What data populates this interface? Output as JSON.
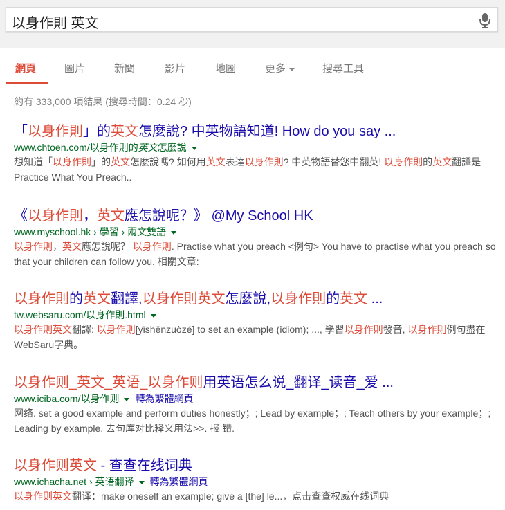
{
  "search": {
    "query": "以身作則 英文"
  },
  "tabs": [
    {
      "label": "網頁"
    },
    {
      "label": "圖片"
    },
    {
      "label": "新聞"
    },
    {
      "label": "影片"
    },
    {
      "label": "地圖"
    },
    {
      "label": "更多"
    },
    {
      "label": "搜尋工具"
    }
  ],
  "stats": "約有 333,000 項結果 (搜尋時間：0.24 秒)",
  "results": [
    {
      "title": [
        [
          "「",
          0
        ],
        [
          "以身作則",
          1
        ],
        [
          "」的",
          0
        ],
        [
          "英文",
          1
        ],
        [
          "怎麼說? 中英物語知道! How do you say ...",
          0
        ]
      ],
      "url": [
        [
          "www.chtoen.com/以身作則的",
          0
        ],
        [
          "英文",
          1
        ],
        [
          "怎麼說",
          0
        ]
      ],
      "translate": "",
      "snippet": [
        [
          "想知道「",
          0
        ],
        [
          "以身作則",
          1
        ],
        [
          "」的",
          0
        ],
        [
          "英文",
          1
        ],
        [
          "怎麼說嗎? 如何用",
          0
        ],
        [
          "英文",
          1
        ],
        [
          "表達",
          0
        ],
        [
          "以身作則",
          1
        ],
        [
          "? 中英物語替您中翻英! ",
          0
        ],
        [
          "以身作則",
          1
        ],
        [
          "的",
          0
        ],
        [
          "英文",
          1
        ],
        [
          "翻譯是Practice What You Preach..",
          0
        ]
      ]
    },
    {
      "title": [
        [
          "《",
          0
        ],
        [
          "以身作則",
          1
        ],
        [
          "，",
          0
        ],
        [
          "英文",
          1
        ],
        [
          "應怎說呢？》 @My School HK",
          0
        ]
      ],
      "url": [
        [
          "www.myschool.hk › 學習 › 兩文雙語",
          0
        ]
      ],
      "translate": "",
      "snippet": [
        [
          "以身作則",
          1
        ],
        [
          "，",
          0
        ],
        [
          "英文",
          1
        ],
        [
          "應怎說呢？ ",
          0
        ],
        [
          "以身作則",
          1
        ],
        [
          ". Practise what you preach <例句> You have to practise what you preach so that your children can follow you. 相關文章:",
          0
        ]
      ]
    },
    {
      "title": [
        [
          "以身作則",
          1
        ],
        [
          "的",
          0
        ],
        [
          "英文",
          1
        ],
        [
          "翻譯,",
          0
        ],
        [
          "以身作則英文",
          1
        ],
        [
          "怎麼說,",
          0
        ],
        [
          "以身作則",
          1
        ],
        [
          "的",
          0
        ],
        [
          "英文",
          1
        ],
        [
          " ...",
          0
        ]
      ],
      "url": [
        [
          "tw.websaru.com/以身作則.html",
          0
        ]
      ],
      "translate": "",
      "snippet": [
        [
          "以身作則英文",
          1
        ],
        [
          "翻譯: ",
          0
        ],
        [
          "以身作則",
          1
        ],
        [
          "[yǐshēnzuòzé] to set an example (idiom); ..., 學習",
          0
        ],
        [
          "以身作則",
          1
        ],
        [
          "發音, ",
          0
        ],
        [
          "以身作則",
          1
        ],
        [
          "例句盡在WebSaru字典。",
          0
        ]
      ]
    },
    {
      "title": [
        [
          "以身作则_英文_英语_以身作则",
          1
        ],
        [
          "用英语怎么说_翻译_读音_爱 ...",
          0
        ]
      ],
      "url": [
        [
          "www.iciba.com/以身作则",
          0
        ]
      ],
      "translate": "轉為繁體網頁",
      "snippet": [
        [
          "网络. set a good example and perform duties honestly；; Lead by example；; Teach others by your example；; Leading by example. 去句库对比释义用法>>. 报 错.",
          0
        ]
      ]
    },
    {
      "title": [
        [
          "以身作则英文",
          1
        ],
        [
          " - 查查在线词典",
          0
        ]
      ],
      "url": [
        [
          "www.ichacha.net › 英语翻译",
          0
        ]
      ],
      "translate": "轉為繁體網頁",
      "snippet": [
        [
          "以身作则英文",
          1
        ],
        [
          "翻译：make oneself an example; give a [the] le...，点击查查权威在线词典",
          0
        ]
      ]
    }
  ]
}
